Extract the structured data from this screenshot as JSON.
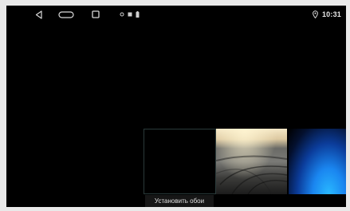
{
  "status_bar": {
    "navigation": {
      "back_icon": "back-triangle-icon",
      "home_icon": "home-pill-icon",
      "recents_icon": "recents-square-icon"
    },
    "notification_icons": [
      "dot-icon",
      "square-notification-icon",
      "battery-icon"
    ],
    "location_icon": "location-pin-icon",
    "time": "10:31"
  },
  "wallpaper_picker": {
    "thumbnails": [
      {
        "name": "current-wallpaper",
        "style": "black"
      },
      {
        "name": "photo-wallpaper",
        "style": "road-photo"
      },
      {
        "name": "blue-glow-wallpaper",
        "style": "blue-glow"
      }
    ],
    "set_wallpaper_label": "Установить обои"
  },
  "colors": {
    "background": "#000000",
    "accent_blue": "#1a86f0",
    "text": "#e6e6e6"
  }
}
